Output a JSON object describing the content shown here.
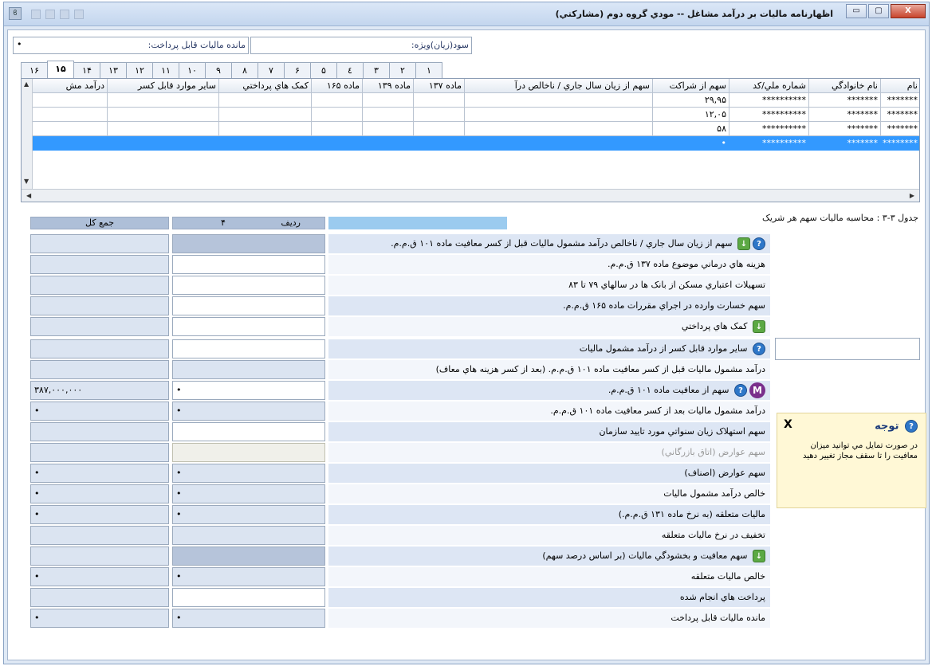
{
  "window": {
    "title": "اظهارنامه ماليات بر درآمد مشاغل -- مودي گروه دوم (مشارکتي)",
    "close_label": "X",
    "min_label": "▭",
    "max_label": "▢"
  },
  "info": {
    "remaining_tax_label": "مانده ماليات قابل پرداخت:",
    "remaining_tax_value": "•",
    "special_profit_label": "سود(زيان)ويژه:"
  },
  "tabs": [
    "١",
    "٢",
    "٣",
    "٤",
    "۵",
    "۶",
    "٧",
    "٨",
    "٩",
    "١٠",
    "١١",
    "١٢",
    "١٣",
    "١۴",
    "١۵",
    "١۶"
  ],
  "active_tab": "١۵",
  "grid": {
    "columns": [
      "نام",
      "نام خانوادگي",
      "شماره ملي/کد",
      "سهم از شراکت",
      "سهم از زيان سال جاري / ناخالص درآ",
      "ماده ١٣٧",
      "ماده ١٣٩",
      "ماده ١۶۵",
      "کمک هاي پرداختي",
      "ساير موارد قابل کسر",
      "درآمد مش"
    ],
    "rows": [
      [
        "*******",
        "*******",
        "**********",
        "٢٩,٩۵"
      ],
      [
        "*******",
        "*******",
        "**********",
        "١٢,٠۵"
      ],
      [
        "*******",
        "*******",
        "**********",
        "۵٨"
      ],
      [
        "********",
        "*******",
        "**********",
        "•"
      ]
    ]
  },
  "calc": {
    "section_title": "جدول ٣-٣ : محاسبه ماليات سهم هر شريک",
    "header_row_label": "رديف",
    "header_col_num": "۴",
    "header_total": "جمع کل",
    "rows": [
      {
        "label": "سهم از زيان سال جاري / ناخالص درآمد مشمول ماليات قبل از کسر معافيت ماده ١٠١ ق.م.م.",
        "value": "",
        "total": ""
      },
      {
        "label": "هزينه هاي درماني موضوع ماده ١٣٧ ق.م.م.",
        "value": "",
        "total": ""
      },
      {
        "label": "تسهيلات اعتباري مسکن از بانک ها در سالهاي ٧٩ تا ٨٣",
        "value": "",
        "total": ""
      },
      {
        "label": "سهم خسارت وارده در اجراي مقررات ماده ١۶۵ ق.م.م.",
        "value": "",
        "total": ""
      },
      {
        "label": "کمک هاي پرداختي",
        "value": "",
        "total": ""
      },
      {
        "label": "ساير موارد قابل کسر از درآمد مشمول ماليات",
        "value": "",
        "total": ""
      },
      {
        "label": "درآمد مشمول ماليات قبل از کسر معافيت ماده ١٠١ ق.م.م. (بعد از کسر هزينه هاي معاف)",
        "value": "",
        "total": ""
      },
      {
        "label": "سهم از معافيت ماده ١٠١ ق.م.م.",
        "value": "•",
        "total": "٣٨٧,٠٠٠,٠٠٠"
      },
      {
        "label": "درآمد مشمول ماليات بعد از کسر معافيت ماده ١٠١ ق.م.م.",
        "value": "•",
        "total": "•"
      },
      {
        "label": "سهم استهلاک زيان سنواتي مورد تاييد سازمان",
        "value": "",
        "total": ""
      },
      {
        "label": "سهم عوارض (اتاق بازرگاني)",
        "value": "",
        "total": ""
      },
      {
        "label": "سهم عوارض (اصناف)",
        "value": "•",
        "total": "•"
      },
      {
        "label": "خالص درآمد مشمول ماليات",
        "value": "•",
        "total": "•"
      },
      {
        "label": "ماليات متعلقه (به نرخ ماده ١٣١ ق.م.م.)",
        "value": "•",
        "total": "•"
      },
      {
        "label": "تخفيف در نرخ ماليات متعلقه",
        "value": "",
        "total": ""
      },
      {
        "label": "سهم معافيت و بخشودگي ماليات (بر اساس درصد سهم)",
        "value": "",
        "total": ""
      },
      {
        "label": "خالص ماليات متعلقه",
        "value": "•",
        "total": "•"
      },
      {
        "label": "پرداخت هاي انجام شده",
        "value": "",
        "total": ""
      },
      {
        "label": "مانده ماليات قابل پرداخت",
        "value": "•",
        "total": "•"
      }
    ]
  },
  "notice": {
    "title": "توجه",
    "close": "X",
    "body": "در صورت تمايل مي توانيد ميزان معافيت را تا سقف مجاز تغيير دهيد"
  }
}
